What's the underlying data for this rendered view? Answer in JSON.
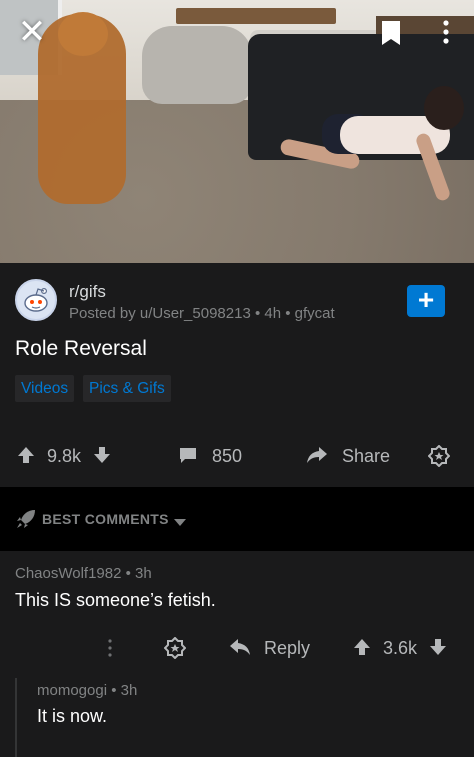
{
  "media": {
    "close_label": "✕",
    "bookmark_icon": "bookmark-icon",
    "menu_icon": "kebab-menu-icon"
  },
  "post": {
    "subreddit": "r/gifs",
    "meta": "Posted by u/User_5098213 • 4h • gfycat",
    "join_label": "+",
    "title": "Role Reversal",
    "flairs": [
      "Videos",
      "Pics & Gifs"
    ],
    "score": "9.8k",
    "comments_count": "850",
    "share_label": "Share"
  },
  "sort": {
    "label": "BEST COMMENTS"
  },
  "comments": [
    {
      "author_meta": "ChaosWolf1982 • 3h",
      "body": "This IS someone’s fetish.",
      "reply_label": "Reply",
      "score": "3.6k"
    },
    {
      "author_meta": "momogogi • 3h",
      "body": "It is now."
    }
  ],
  "colors": {
    "accent": "#0079d3",
    "background": "#1a1a1b",
    "muted_text": "#818384"
  }
}
